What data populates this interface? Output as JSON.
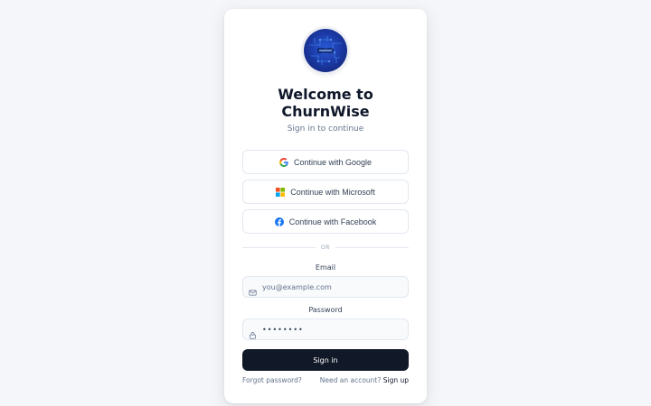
{
  "app": {
    "title_line1": "Welcome to",
    "title_line2": "ChurnWise",
    "subtitle": "Sign in to continue"
  },
  "social": {
    "google_label": "Continue with Google",
    "microsoft_label": "Continue with Microsoft",
    "facebook_label": "Continue with Facebook"
  },
  "divider": {
    "label": "OR"
  },
  "form": {
    "email_label": "Email",
    "email_placeholder": "you@example.com",
    "password_label": "Password",
    "password_value": "••••••••",
    "signin_label": "Sign in"
  },
  "footer": {
    "forgot_label": "Forgot password?",
    "need_account": "Need an account?",
    "signup_label": "Sign up"
  },
  "colors": {
    "background": "#f4f6f9",
    "card": "#ffffff",
    "primary_button": "#111827",
    "muted_text": "#64748b",
    "logo_blue": "#1c3ba8"
  },
  "icons": {
    "google": "google-icon",
    "microsoft": "microsoft-icon",
    "facebook": "facebook-icon",
    "email": "mail-icon",
    "password": "lock-icon"
  }
}
